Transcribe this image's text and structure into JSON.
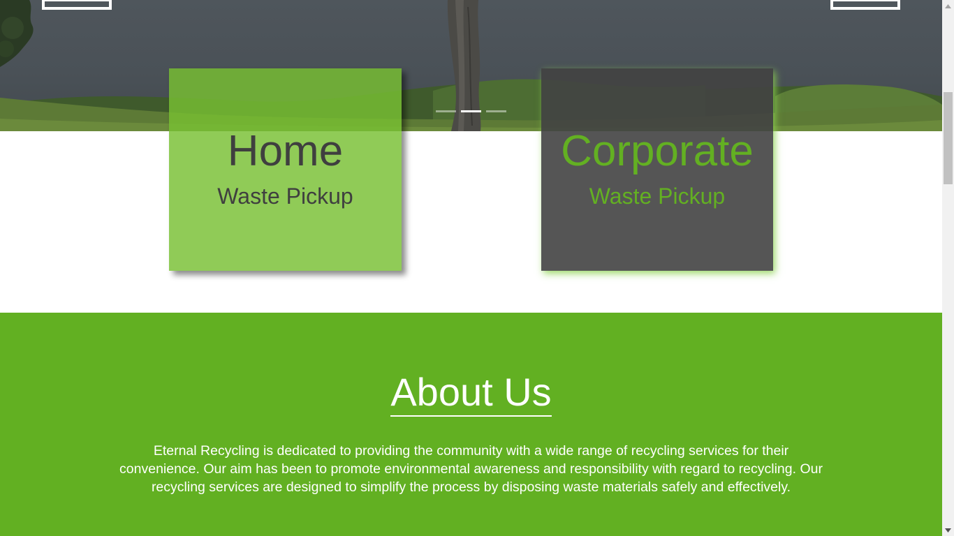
{
  "slider": {
    "dots": [
      {
        "name": "slider-dot-1",
        "active": false
      },
      {
        "name": "slider-dot-2",
        "active": true
      },
      {
        "name": "slider-dot-3",
        "active": false
      }
    ]
  },
  "services": {
    "home": {
      "title": "Home",
      "subtitle": "Waste Pickup"
    },
    "corporate": {
      "title": "Corporate",
      "subtitle": "Waste Pickup"
    }
  },
  "about": {
    "title": "About Us",
    "text": "Eternal Recycling is dedicated to providing the community with a wide range of recycling services for their convenience. Our aim has been to promote environmental awareness and responsibility with regard to recycling. Our recycling services are designed to simplify the process by disposing waste materials safely and effectively."
  },
  "colors": {
    "brand_green": "#62b022",
    "card_green": "#78c032",
    "card_dark": "#424242",
    "text_dark": "#3f3f3f"
  },
  "icons": {
    "scroll_up": "triangle-up-icon",
    "scroll_down": "triangle-down-icon"
  }
}
